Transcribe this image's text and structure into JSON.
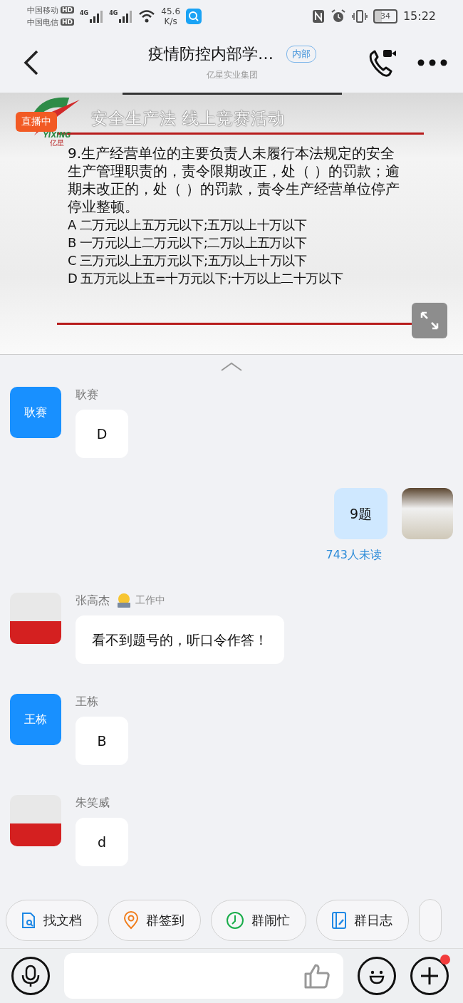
{
  "status_bar": {
    "carriers": [
      {
        "name": "中国移动",
        "badge": "HD"
      },
      {
        "name": "中国电信",
        "badge": "HD"
      }
    ],
    "signals": [
      "4G",
      "4G"
    ],
    "speed": "45.6",
    "speed_unit": "K/s",
    "battery": "34",
    "time": "15:22"
  },
  "header": {
    "title": "疫情防控内部学…",
    "tag": "内部",
    "subtitle": "亿星实业集团"
  },
  "live": {
    "badge": "直播中",
    "slide": {
      "logo_text": "YIXING",
      "logo_caption": "亿星",
      "title": "安全生产法 线上竞赛活动",
      "question": "9.生产经营单位的主要负责人未履行本法规定的安全生产管理职责的，责令限期改正，处（  ）的罚款；逾期未改正的，处（  ）的罚款，责令生产经营单位停产停业整顿。",
      "options": [
        "A 二万元以上五万元以下;五万以上十万以下",
        "B 一万元以上二万元以下;二万以上五万以下",
        "C 三万元以上五万元以下;五万以上十万以下",
        "D 五万元以上五=十万元以下;十万以上二十万以下"
      ]
    }
  },
  "messages": [
    {
      "kind": "incoming",
      "sender": "耿赛",
      "avatar": {
        "kind": "text",
        "text": "耿赛"
      },
      "text": "D"
    },
    {
      "kind": "outgoing",
      "avatar": {
        "kind": "photo"
      },
      "text": "9题",
      "unread": "743人未读"
    },
    {
      "kind": "incoming",
      "sender": "张高杰",
      "status": "工作中",
      "avatar": {
        "kind": "photo"
      },
      "text": "看不到题号的，听口令作答！"
    },
    {
      "kind": "incoming",
      "sender": "王栋",
      "avatar": {
        "kind": "text",
        "text": "王栋"
      },
      "text": "B"
    },
    {
      "kind": "incoming",
      "sender": "朱笑威",
      "avatar": {
        "kind": "photo"
      },
      "text": "d"
    }
  ],
  "quick_actions": [
    {
      "label": "找文档",
      "kind": "document",
      "color": "#1e88e5"
    },
    {
      "label": "群签到",
      "kind": "checkin",
      "color": "#f07c1a"
    },
    {
      "label": "群闹忙",
      "kind": "busy",
      "color": "#1aad4b"
    },
    {
      "label": "群日志",
      "kind": "log",
      "color": "#1e88e5"
    }
  ],
  "input_bar": {
    "plus_badge": true
  }
}
